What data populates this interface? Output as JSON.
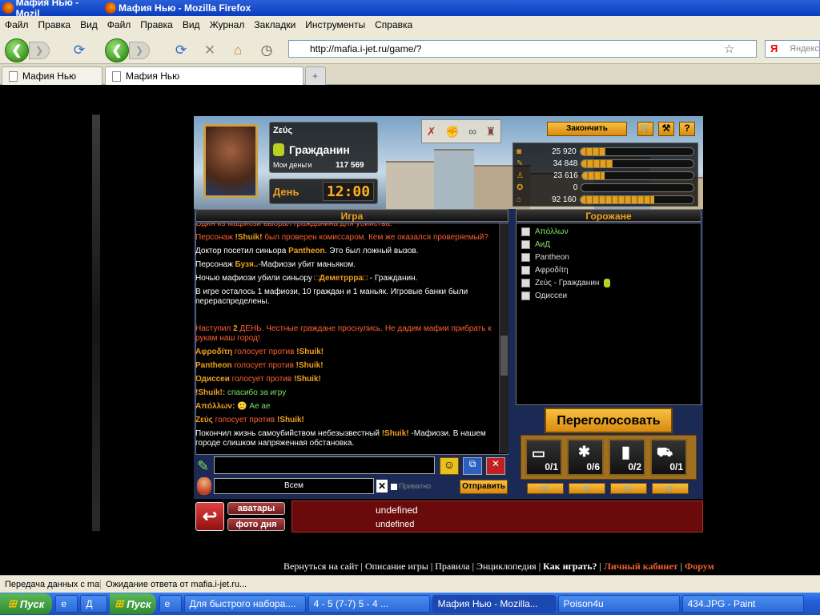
{
  "window": {
    "title_1": "Мафия Нью - Mozil",
    "title_2": "Мафия Нью - Mozilla Firefox"
  },
  "menu": [
    "Файл",
    "Правка",
    "Вид",
    "Файл",
    "Правка",
    "Вид",
    "Журнал",
    "Закладки",
    "Инструменты",
    "Справка"
  ],
  "address": {
    "url": "http://mafia.i-jet.ru/game/?"
  },
  "search": {
    "engine": "Я",
    "placeholder": "Яндекс"
  },
  "tabs": [
    {
      "label": "Мафия Нью"
    },
    {
      "label": "Мафия Нью"
    }
  ],
  "player": {
    "name": "Ζεύς",
    "role": "Гражданин",
    "money_label": "Мои деньги",
    "money_value": "117 569",
    "phase": "День",
    "clock": "12:00"
  },
  "buttons": {
    "finish": "Закончить",
    "revote": "Переголосовать",
    "send": "Отправить",
    "avatars": "аватары",
    "day_photo": "фото дня",
    "help": "?"
  },
  "stats": [
    {
      "value": "25 920",
      "fill": 0.22
    },
    {
      "value": "34 848",
      "fill": 0.28
    },
    {
      "value": "23 616",
      "fill": 0.2
    },
    {
      "value": "0",
      "fill": 0
    },
    {
      "value": "92 160",
      "fill": 0.65
    }
  ],
  "chat_panel": {
    "title": "Игра",
    "messages": [
      {
        "parts": [
          {
            "t": "Один из мафиози выбрал гражданина для убийства.",
            "c": "r"
          }
        ]
      },
      {
        "parts": [
          {
            "t": "Персонаж ",
            "c": "r"
          },
          {
            "t": "!Shuik!",
            "c": "o"
          },
          {
            "t": " был проверен комиссаром. Кем же оказался проверяемый?",
            "c": "r"
          }
        ]
      },
      {
        "parts": [
          {
            "t": "Доктор посетил синьора ",
            "c": "w"
          },
          {
            "t": "Pantheon",
            "c": "o"
          },
          {
            "t": ". Это был ложный вызов.",
            "c": "w"
          }
        ]
      },
      {
        "parts": [
          {
            "t": "Персонаж ",
            "c": "w"
          },
          {
            "t": "Бузя..",
            "c": "o"
          },
          {
            "t": "-Мафиози убит маньяком.",
            "c": "w"
          }
        ]
      },
      {
        "parts": [
          {
            "t": "Ночью мафиози убили синьору ",
            "c": "w"
          },
          {
            "t": "□Деметррра□",
            "c": "o"
          },
          {
            "t": " - Гражданин.",
            "c": "w"
          }
        ]
      },
      {
        "parts": [
          {
            "t": "В игре осталось 1 мафиози, 10 граждан и 1 маньяк. Игровые банки были перераспределены.",
            "c": "w"
          }
        ]
      },
      {
        "parts": [
          {
            "t": "",
            "c": "w"
          }
        ]
      },
      {
        "parts": [
          {
            "t": "Наступил ",
            "c": "r"
          },
          {
            "t": "2",
            "c": "o"
          },
          {
            "t": " ДЕНЬ. Честные граждане проснулись. Не дадим мафии прибрать к рукам наш город!",
            "c": "r"
          }
        ]
      },
      {
        "parts": [
          {
            "t": "Αφροδίτη",
            "c": "o"
          },
          {
            "t": " голосует против ",
            "c": "r"
          },
          {
            "t": "!Shuik!",
            "c": "o"
          }
        ]
      },
      {
        "parts": [
          {
            "t": "Pantheon",
            "c": "o"
          },
          {
            "t": " голосует против ",
            "c": "r"
          },
          {
            "t": "!Shuik!",
            "c": "o"
          }
        ]
      },
      {
        "parts": [
          {
            "t": "Одиссеи",
            "c": "o"
          },
          {
            "t": " голосует против ",
            "c": "r"
          },
          {
            "t": "!Shuik!",
            "c": "o"
          }
        ]
      },
      {
        "parts": [
          {
            "t": "!Shuik!:",
            "c": "o"
          },
          {
            "t": " спасибо за игру",
            "c": "g"
          }
        ]
      },
      {
        "parts": [
          {
            "t": "Απόλλων:",
            "c": "o"
          },
          {
            "t": " 🙂  Ае ае",
            "c": "g"
          }
        ]
      },
      {
        "parts": [
          {
            "t": "Ζεύς",
            "c": "o"
          },
          {
            "t": " голосует против ",
            "c": "r"
          },
          {
            "t": "!Shuik!",
            "c": "o"
          }
        ]
      },
      {
        "parts": [
          {
            "t": "Покончил жизнь самоубийством небезызвестный ",
            "c": "w"
          },
          {
            "t": "!Shuik!",
            "c": "o"
          },
          {
            "t": " -Мафиози. В нашем городе слишком напряженная обстановка.",
            "c": "w"
          }
        ]
      }
    ]
  },
  "citizens_panel": {
    "title": "Горожане",
    "players": [
      {
        "name": "Απόλλων",
        "color": "#7ee060"
      },
      {
        "name": "АиД",
        "color": "#7ee060"
      },
      {
        "name": "Pantheon",
        "color": "#dddddd"
      },
      {
        "name": "Αφροδίτη",
        "color": "#dddddd"
      },
      {
        "name": "Ζεύς - Гражданин",
        "color": "#dddddd"
      },
      {
        "name": "Одиссеи",
        "color": "#dddddd"
      }
    ]
  },
  "chat_input": {
    "recipient": "Всем",
    "private_label": "Приватно"
  },
  "slots": [
    {
      "count": "0/1"
    },
    {
      "count": "0/6"
    },
    {
      "count": "0/2"
    },
    {
      "count": "0/1"
    }
  ],
  "info": {
    "line1": "undefined",
    "line2": "undefined"
  },
  "footer": {
    "links": [
      "Вернуться на сайт",
      "Описание игры",
      "Правила",
      "Энциклопедия",
      "Как играть?",
      "Личный кабинет",
      "Форум"
    ]
  },
  "statusbar": {
    "left": "Передача данных с maf",
    "right": "Ожидание ответа от mafia.i-jet.ru..."
  },
  "taskbar": {
    "start_1": "Пуск",
    "start_2": "Пуск",
    "items": [
      "Д",
      "Для быстрого набора....",
      "4 - 5  (7-7)          5 - 4  ...",
      "Мафия Нью - Mozilla...",
      "Poison4u",
      "434.JPG - Paint"
    ]
  }
}
